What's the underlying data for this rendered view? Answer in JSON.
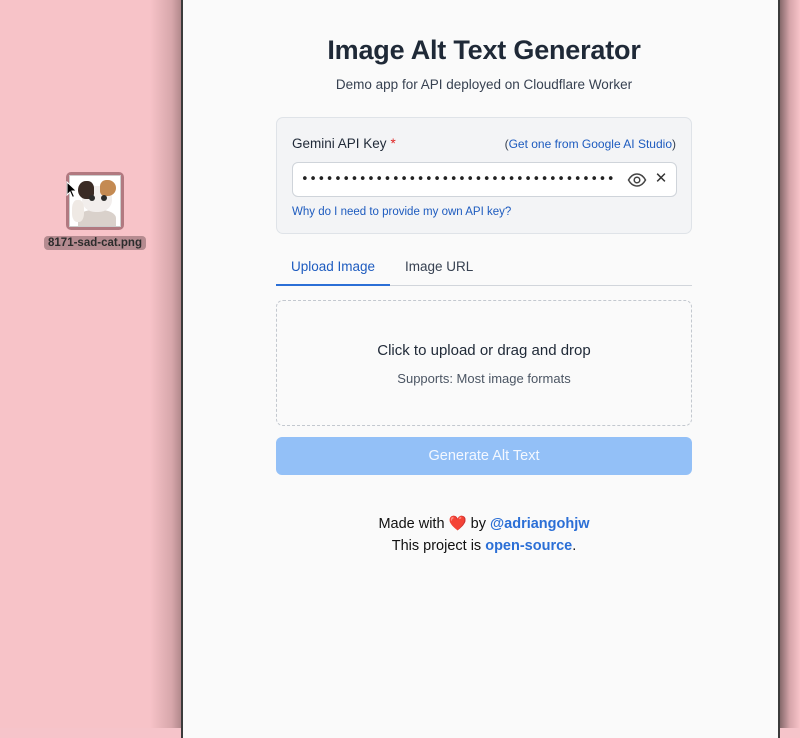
{
  "desktop": {
    "file_icon": {
      "filename": "8171-sad-cat.png"
    }
  },
  "app": {
    "title": "Image Alt Text Generator",
    "subtitle": "Demo app for API deployed on Cloudflare Worker",
    "api_key": {
      "label": "Gemini API Key",
      "required_mark": "*",
      "help_link_prefix": "(",
      "help_link_text": "Get one from Google AI Studio",
      "help_link_suffix": ")",
      "value_masked": "••••••••••••••••••••••••••••••••••••••",
      "why_link": "Why do I need to provide my own API key?"
    },
    "tabs": [
      {
        "label": "Upload Image",
        "active": true
      },
      {
        "label": "Image URL",
        "active": false
      }
    ],
    "dropzone": {
      "primary": "Click to upload or drag and drop",
      "secondary": "Supports: Most image formats"
    },
    "generate_button": {
      "label": "Generate Alt Text",
      "disabled": true
    },
    "footer": {
      "made_with": "Made with",
      "heart": "❤️",
      "by": "by",
      "author": "@adriangohjw",
      "project_prefix": "This project is",
      "project_link": "open-source",
      "project_suffix": "."
    }
  },
  "colors": {
    "desktop_bg": "#f7c3c8",
    "accent": "#2b6fd6",
    "button_disabled": "#93c0f7",
    "required": "#e02424"
  }
}
